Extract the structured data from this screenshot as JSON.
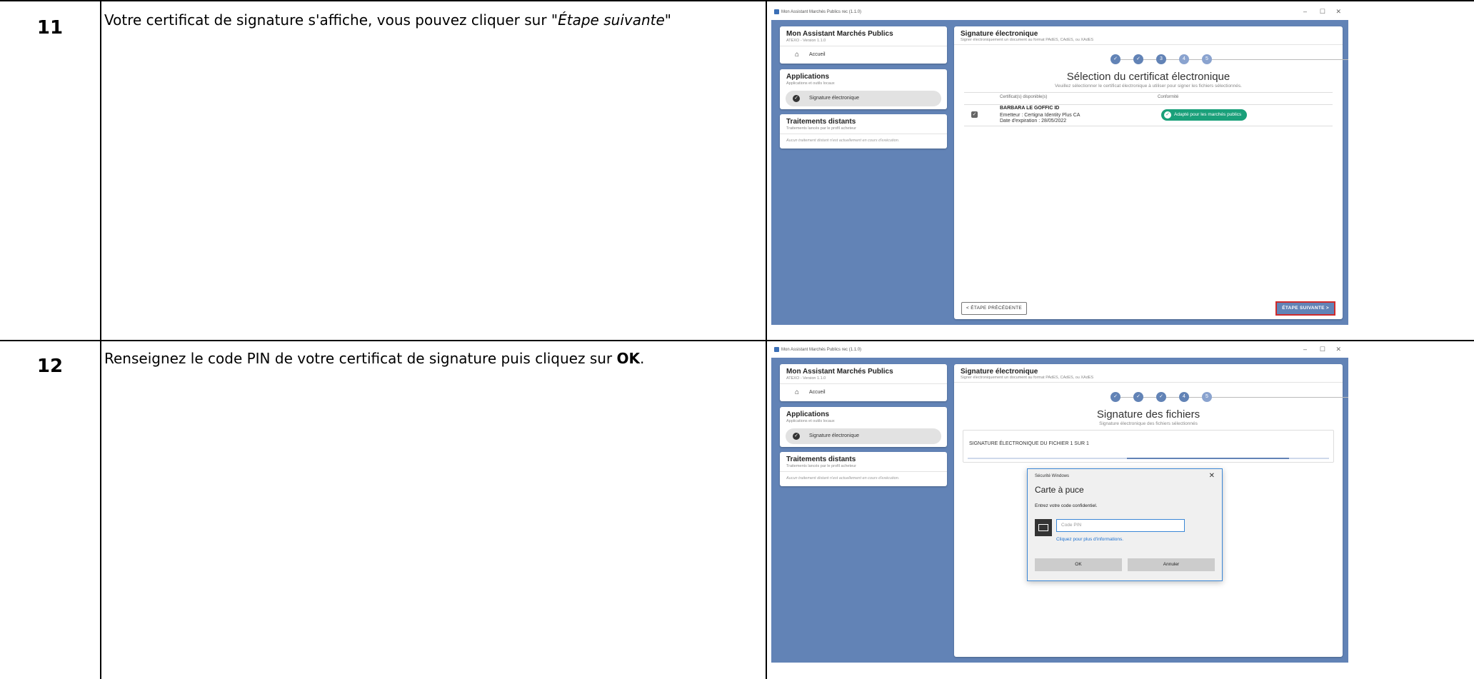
{
  "rows": [
    {
      "number": "11",
      "instruction": {
        "before": "Votre certificat de signature s'affiche, vous pouvez cliquer sur \"",
        "emphasis": "Étape suivante",
        "after": "\""
      }
    },
    {
      "number": "12",
      "instruction": {
        "before": "Renseignez le code PIN de votre certificat de signature puis cliquez sur ",
        "bold": "OK",
        "after": "."
      }
    }
  ],
  "app": {
    "window_title_1": "Mon Assistant Marchés Publics rec (1.1.0)",
    "window_title_2": "Mon Assistant Marchés Publics rec (1.1.0)",
    "minimize": "–",
    "maximize": "☐",
    "close": "✕",
    "sidebar": {
      "title": "Mon Assistant Marchés Publics",
      "version": "ATEXO - Version 1.1.0",
      "home": "Accueil",
      "apps_title": "Applications",
      "apps_sub": "Applications et outils locaux",
      "sig_item": "Signature électronique",
      "remote_title": "Traitements distants",
      "remote_sub": "Traitements lancés par le profil acheteur",
      "remote_empty": "Aucun traitement distant n'est actuellement en cours d'exécution."
    },
    "main_title": "Signature électronique",
    "main_sub": "Signer électroniquement un document au format PAdES, CAdES, ou XAdES",
    "steps": [
      "✓",
      "✓",
      "3",
      "4",
      "5"
    ],
    "steps_2": [
      "✓",
      "✓",
      "✓",
      "4",
      "5"
    ]
  },
  "screen1": {
    "heading": "Sélection du certificat électronique",
    "subheading": "Veuillez sélectionner le certificat électronique à utiliser pour signer les fichiers sélectionnés.",
    "col_cert": "Certificat(s) disponible(s)",
    "col_conf": "Conformité",
    "cert_name": "BARBARA LE GOFFIC ID",
    "cert_issuer": "Emetteur : Certigna Identity Plus CA",
    "cert_expiry": "Date d'expiration : 28/05/2022",
    "conformity": "Adapté pour les marchés publics",
    "prev_btn": "< ÉTAPE PRÉCÉDENTE",
    "next_btn": "ÉTAPE SUIVANTE >"
  },
  "screen2": {
    "heading": "Signature des fichiers",
    "subheading": "Signature électronique des fichiers sélectionnés",
    "progress_label": "SIGNATURE ÉLECTRONIQUE DU FICHIER 1 SUR 1",
    "progress_fraction": 0.45,
    "dialog": {
      "title": "Sécurité Windows",
      "close": "✕",
      "heading": "Carte à puce",
      "prompt": "Entrez votre code confidentiel.",
      "pin_placeholder": "Code PIN",
      "link": "Cliquez pour plus d'informations.",
      "ok": "OK",
      "cancel": "Annuler"
    }
  }
}
